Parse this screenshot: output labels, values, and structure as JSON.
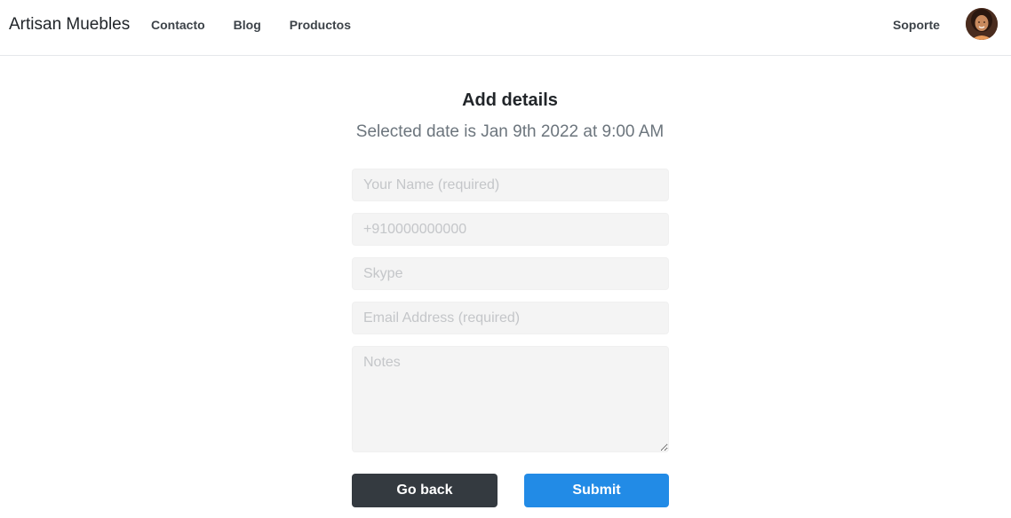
{
  "navbar": {
    "brand": "Artisan Muebles",
    "links": [
      "Contacto",
      "Blog",
      "Productos"
    ],
    "support": "Soporte",
    "avatar_icon": "user-avatar"
  },
  "form": {
    "title": "Add details",
    "subtitle": "Selected date is Jan 9th 2022 at 9:00 AM",
    "name_placeholder": "Your Name (required)",
    "name_value": "",
    "phone_placeholder": "+910000000000",
    "phone_value": "",
    "skype_placeholder": "Skype",
    "skype_value": "",
    "email_placeholder": "Email Address (required)",
    "email_value": "",
    "notes_placeholder": "Notes",
    "notes_value": "",
    "back_label": "Go back",
    "submit_label": "Submit"
  },
  "colors": {
    "field_bg": "#f4f4f4",
    "back_button": "#343a40",
    "submit_button": "#228be6"
  }
}
